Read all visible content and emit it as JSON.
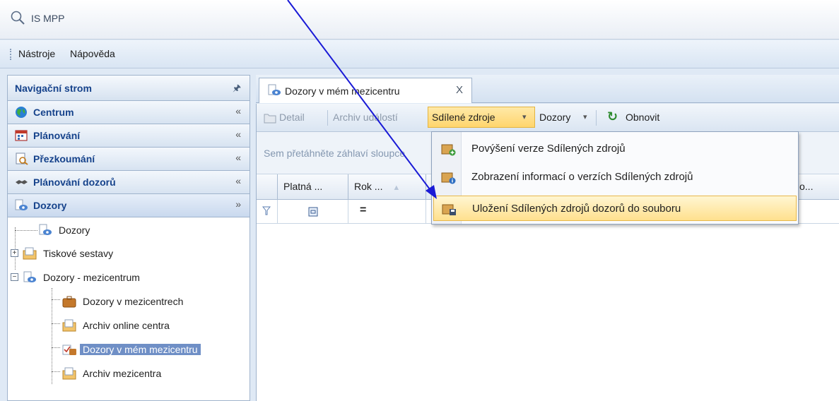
{
  "app": {
    "title": "IS MPP"
  },
  "menubar": {
    "items": [
      "Nástroje",
      "Nápověda"
    ]
  },
  "left_panel": {
    "title": "Navigační strom",
    "sections": [
      {
        "label": "Centrum",
        "icon": "globe-icon"
      },
      {
        "label": "Plánování",
        "icon": "calendar-icon"
      },
      {
        "label": "Přezkoumání",
        "icon": "review-icon"
      },
      {
        "label": "Plánování dozorů",
        "icon": "handshake-icon"
      },
      {
        "label": "Dozory",
        "icon": "dozory-icon"
      }
    ],
    "tree": [
      {
        "label": "Dozory",
        "icon": "dozory-icon"
      },
      {
        "label": "Tiskové sestavy",
        "icon": "folder-report-icon"
      },
      {
        "label": "Dozory - mezicentrum",
        "icon": "dozory-icon"
      },
      {
        "label": "Dozory v mezicentrech",
        "icon": "briefcase-icon"
      },
      {
        "label": "Archiv online centra",
        "icon": "folder-report-icon"
      },
      {
        "label": "Dozory v mém mezicentru",
        "icon": "checklist-icon"
      },
      {
        "label": "Archiv mezicentra",
        "icon": "folder-report-icon"
      }
    ]
  },
  "tab": {
    "label": "Dozory v mém mezicentru",
    "close": "X"
  },
  "toolbar": {
    "detail": "Detail",
    "archive": "Archiv událostí",
    "shared": "Sdílené zdroje",
    "dozory": "Dozory",
    "refresh": "Obnovit"
  },
  "grid": {
    "group_hint": "Sem přetáhněte záhlaví sloupce",
    "columns": [
      "Platná ...",
      "Rok ...",
      "o..."
    ]
  },
  "dropdown": {
    "items": [
      "Povýšení verze Sdílených zdrojů",
      "Zobrazení informací o verzích Sdílených zdrojů",
      "Uložení Sdílených zdrojů dozorů do souboru"
    ]
  },
  "colors": {
    "accent": "#15428b",
    "selection": "#6f8fc6",
    "highlight": "#ffd56d",
    "annotation_arrow": "#1a1ad6"
  }
}
